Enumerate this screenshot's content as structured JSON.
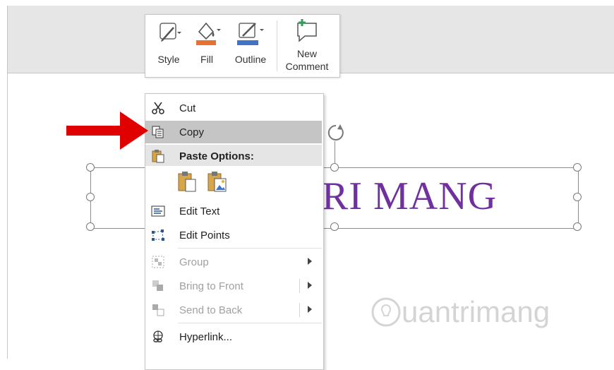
{
  "mini_toolbar": {
    "style_label": "Style",
    "fill_label": "Fill",
    "outline_label": "Outline",
    "new_comment_line1": "New",
    "new_comment_line2": "Comment"
  },
  "shape": {
    "text": "RI MANG"
  },
  "context_menu": {
    "items": [
      {
        "label": "Cut",
        "icon": "scissors-icon",
        "enabled": true
      },
      {
        "label": "Copy",
        "icon": "copy-icon",
        "enabled": true,
        "highlighted": true
      },
      {
        "label": "Paste Options:",
        "icon": "paste-icon",
        "header": true
      },
      {
        "label": "Edit Text",
        "icon": "edit-text-icon",
        "enabled": true
      },
      {
        "label": "Edit Points",
        "icon": "edit-points-icon",
        "enabled": true
      },
      {
        "label": "Group",
        "icon": "group-icon",
        "enabled": false,
        "submenu": true
      },
      {
        "label": "Bring to Front",
        "icon": "bring-front-icon",
        "enabled": false,
        "submenu": true
      },
      {
        "label": "Send to Back",
        "icon": "send-back-icon",
        "enabled": false,
        "submenu": true
      },
      {
        "label": "Hyperlink...",
        "icon": "hyperlink-icon",
        "enabled": true
      }
    ]
  },
  "watermark": "uantrimang",
  "colors": {
    "fill_accent": "#e97132",
    "outline_accent": "#4472c4",
    "text_purple": "#7030a0",
    "arrow_red": "#e00000"
  }
}
